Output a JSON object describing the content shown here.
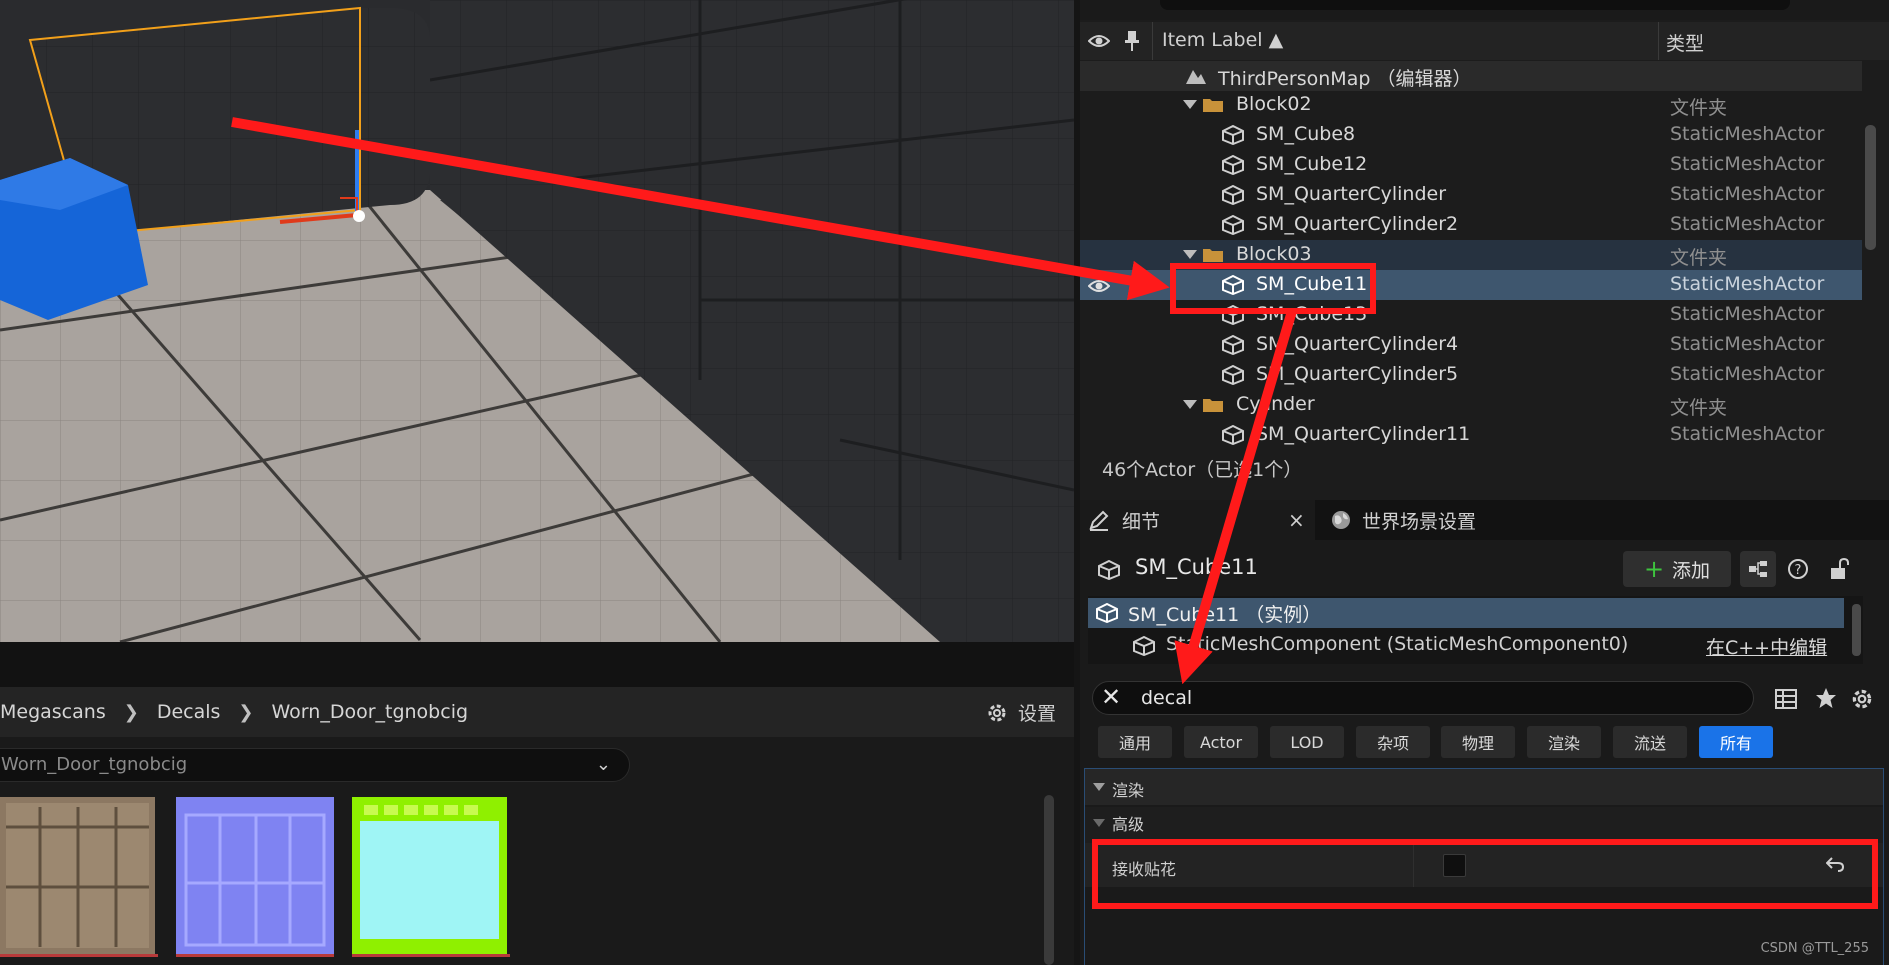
{
  "outliner": {
    "columns": {
      "item_label": "Item Label ▲",
      "type": "类型"
    },
    "map_row": "ThirdPersonMap （编辑器）",
    "rows": [
      {
        "label": "Block02",
        "type": "文件夹"
      },
      {
        "label": "SM_Cube8",
        "type": "StaticMeshActor"
      },
      {
        "label": "SM_Cube12",
        "type": "StaticMeshActor"
      },
      {
        "label": "SM_QuarterCylinder",
        "type": "StaticMeshActor"
      },
      {
        "label": "SM_QuarterCylinder2",
        "type": "StaticMeshActor"
      },
      {
        "label": "Block03",
        "type": "文件夹"
      },
      {
        "label": "SM_Cube11",
        "type": "StaticMeshActor"
      },
      {
        "label": "SM_Cube13",
        "type": "StaticMeshActor"
      },
      {
        "label": "SM_QuarterCylinder4",
        "type": "StaticMeshActor"
      },
      {
        "label": "SM_QuarterCylinder5",
        "type": "StaticMeshActor"
      },
      {
        "label": "Cylinder",
        "type": "文件夹"
      },
      {
        "label": "SM_QuarterCylinder11",
        "type": "StaticMeshActor"
      }
    ],
    "status": "46个Actor（已选1个）"
  },
  "details": {
    "tab_details": "细节",
    "tab_world": "世界场景设置",
    "actor_name": "SM_Cube11",
    "add_label": "添加",
    "component_root": "SM_Cube11 （实例）",
    "component_child": "StaticMeshComponent (StaticMeshComponent0)",
    "edit_in_cpp": "在C++中编辑",
    "search_value": "decal",
    "filters": [
      "通用",
      "Actor",
      "LOD",
      "杂项",
      "物理",
      "渲染",
      "流送",
      "所有"
    ],
    "active_filter": "所有",
    "category_render": "渲染",
    "category_advanced": "高级",
    "property_label": "接收贴花",
    "property_value": false
  },
  "content_browser": {
    "breadcrumb": [
      "Megascans",
      "Decals",
      "Worn_Door_tgnobcig"
    ],
    "settings_label": "设置",
    "path_value": "Worn_Door_tgnobcig"
  },
  "watermark": "CSDN @TTL_255",
  "colors": {
    "selection": "#3e566e",
    "accent": "#1a73e8",
    "annotation": "#ff1a1a",
    "actor_blue": "#1565d8",
    "selection_outline": "#f2a01a"
  }
}
